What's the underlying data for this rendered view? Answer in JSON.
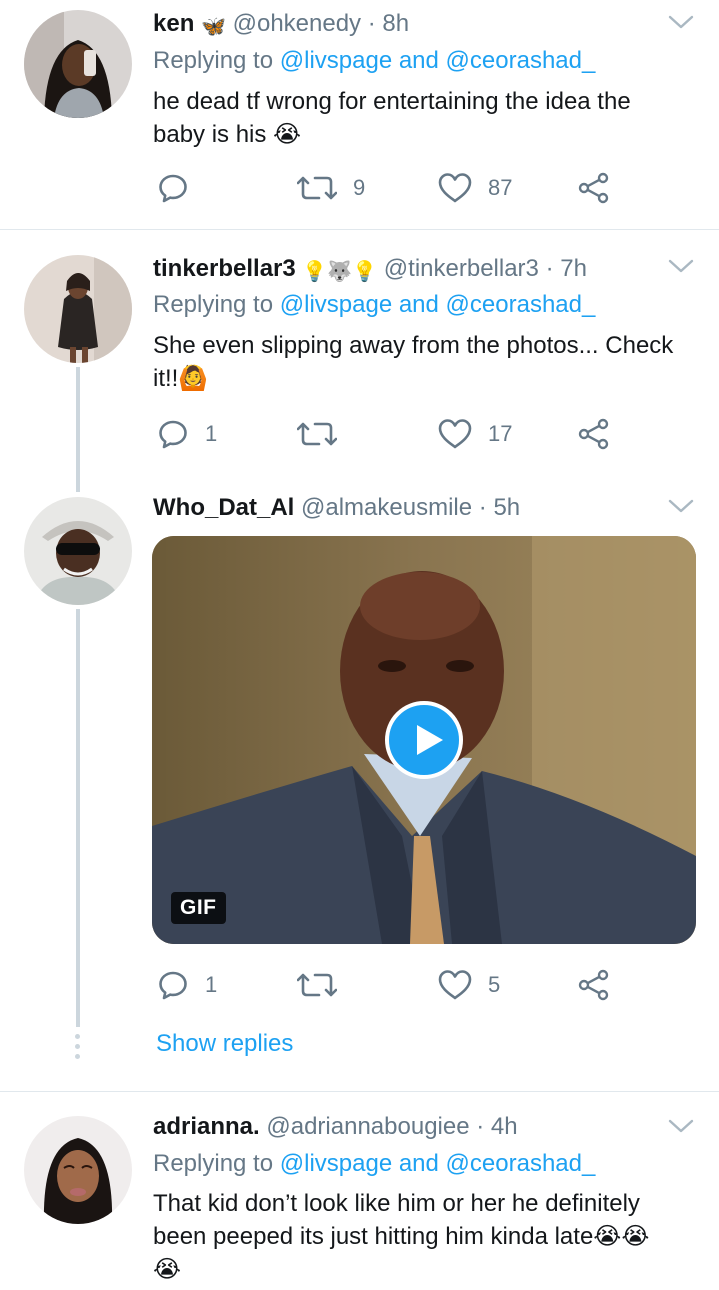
{
  "tweets": [
    {
      "name": "ken",
      "name_emoji": "🦋",
      "handle": "@ohkenedy",
      "dot": "·",
      "time": "8h",
      "reply_prefix": "Replying to",
      "reply_to": "@livspage and @ceorashad_",
      "text_lines": [
        "he dead tf wrong for entertaining the idea the",
        "baby is his 😭"
      ],
      "replies": "",
      "retweets": "9",
      "likes": "87"
    },
    {
      "name": "tinkerbellar3",
      "name_emoji": "💡🐺💡",
      "handle": "@tinkerbellar3",
      "dot": "·",
      "time": "7h",
      "reply_prefix": "Replying to",
      "reply_to": "@livspage and @ceorashad_",
      "text_lines": [
        "She even slipping away from the photos... Check",
        "it!!🙆"
      ],
      "replies": "1",
      "retweets": "",
      "likes": "17"
    },
    {
      "name": "Who_Dat_Al",
      "handle": "@almakeusmile",
      "dot": "·",
      "time": "5h",
      "media_badge": "GIF",
      "replies": "1",
      "retweets": "",
      "likes": "5",
      "show_replies": "Show replies"
    },
    {
      "name": "adrianna.",
      "handle": "@adriannabougiee",
      "dot": "·",
      "time": "4h",
      "reply_prefix": "Replying to",
      "reply_to": "@livspage and @ceorashad_",
      "text_lines": [
        "That kid don’t look like him or her he definitely",
        "been peeped its just hitting him kinda late😭😭",
        "😭"
      ]
    }
  ],
  "colors": {
    "accent": "#1da1f2",
    "secondary_text": "#657786",
    "divider": "#e1e8ed",
    "thread_line": "#ccd6dd"
  },
  "icons": [
    "reply-icon",
    "retweet-icon",
    "like-icon",
    "share-icon",
    "caret-down-icon",
    "play-icon"
  ]
}
